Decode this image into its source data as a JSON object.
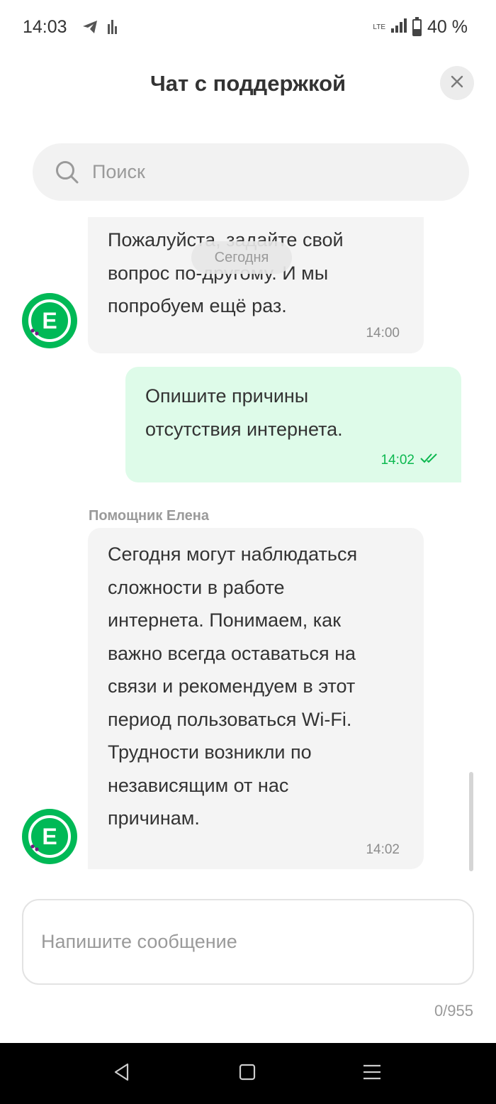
{
  "status_bar": {
    "time": "14:03",
    "network": "LTE",
    "battery": "40 %"
  },
  "header": {
    "title": "Чат с поддержкой"
  },
  "search": {
    "placeholder": "Поиск"
  },
  "chat": {
    "date_separator": "Сегодня",
    "messages": [
      {
        "direction": "incoming",
        "lines": [
          "Пожалуйста, задайте свой",
          "вопрос по-другому. И мы",
          "попробуем ещё раз."
        ],
        "time": "14:00",
        "avatar_letter": "E"
      },
      {
        "direction": "outgoing",
        "lines": [
          "Опишите причины",
          "отсутствия интернета."
        ],
        "time": "14:02",
        "status": "read"
      },
      {
        "direction": "incoming",
        "sender": "Помощник Елена",
        "lines": [
          "Сегодня могут наблюдаться",
          "сложности в работе",
          "интернета. Понимаем, как",
          "важно всегда оставаться на",
          "связи и рекомендуем в этот",
          "период пользоваться Wi-Fi.",
          "Трудности возникли по",
          "независящим от нас",
          "причинам."
        ],
        "time": "14:02",
        "avatar_letter": "E"
      }
    ]
  },
  "composer": {
    "placeholder": "Напишите сообщение",
    "counter": "0/955"
  },
  "colors": {
    "brand_green": "#00b956",
    "outgoing_bubble": "#defbe9",
    "incoming_bubble": "#f4f4f4",
    "read_check": "#0bb84f"
  },
  "icons": {
    "close": "close-icon",
    "search": "search-icon",
    "read_status": "double-check-icon",
    "nav_back": "nav-back-icon",
    "nav_home": "nav-home-icon",
    "nav_menu": "nav-menu-icon"
  }
}
